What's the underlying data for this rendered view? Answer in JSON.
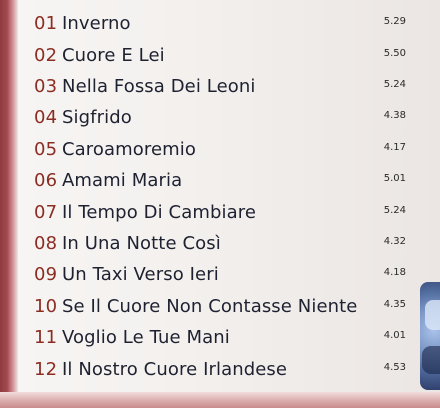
{
  "tracks": [
    {
      "number": "01",
      "title": "Inverno",
      "duration": "5.29"
    },
    {
      "number": "02",
      "title": "Cuore E Lei",
      "duration": "5.50"
    },
    {
      "number": "03",
      "title": "Nella Fossa Dei Leoni",
      "duration": "5.24"
    },
    {
      "number": "04",
      "title": "Sigfrido",
      "duration": "4.38"
    },
    {
      "number": "05",
      "title": "Caroamoremio",
      "duration": "4.17"
    },
    {
      "number": "06",
      "title": "Amami Maria",
      "duration": "5.01"
    },
    {
      "number": "07",
      "title": "Il Tempo Di Cambiare",
      "duration": "5.24"
    },
    {
      "number": "08",
      "title": "In Una Notte Così",
      "duration": "4.32"
    },
    {
      "number": "09",
      "title": "Un Taxi Verso Ieri",
      "duration": "4.18"
    },
    {
      "number": "10",
      "title": "Se Il Cuore Non Contasse Niente",
      "duration": "4.35"
    },
    {
      "number": "11",
      "title": "Voglio Le Tue Mani",
      "duration": "4.01"
    },
    {
      "number": "12",
      "title": "Il Nostro Cuore Irlandese",
      "duration": "4.53"
    }
  ]
}
